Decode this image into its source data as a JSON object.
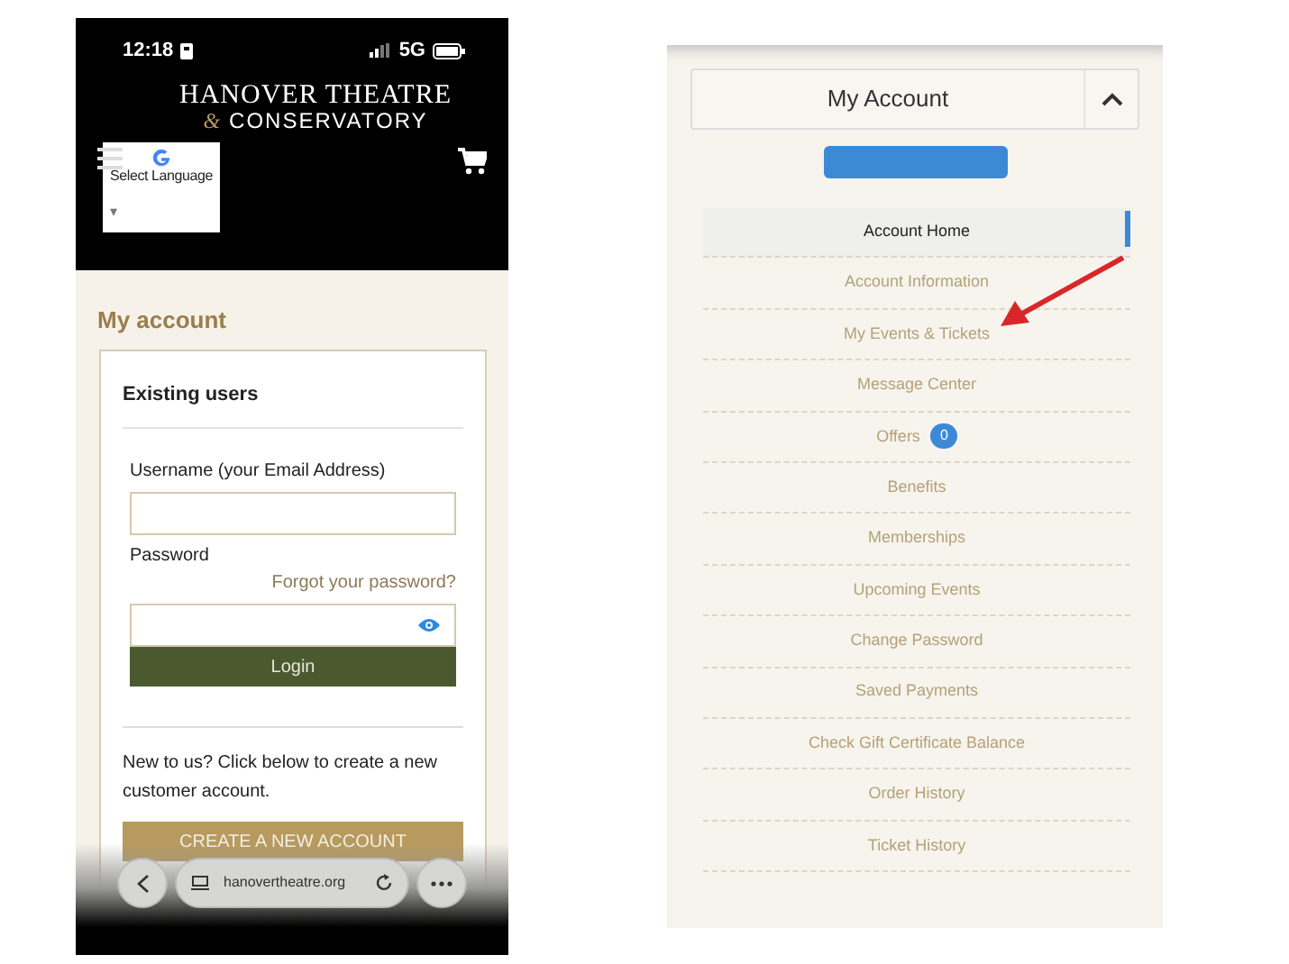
{
  "status_bar": {
    "time": "12:18",
    "network": "5G"
  },
  "logo": {
    "line1": "HANOVER THEATRE",
    "ampersand": "&",
    "line2": "CONSERVATORY"
  },
  "language_widget": {
    "label": "Select Language",
    "caret": "▾"
  },
  "account_page": {
    "heading": "My account",
    "section_title": "Existing users",
    "username_label": "Username (your Email Address)",
    "password_label": "Password",
    "forgot_link": "Forgot your password?",
    "login_button": "Login",
    "new_customer_text": "New to us? Click below to create a new customer account.",
    "create_button": "CREATE A NEW ACCOUNT"
  },
  "browser_bar": {
    "url": "hanovertheatre.org"
  },
  "account_menu": {
    "title": "My Account",
    "expanded": true,
    "items": [
      {
        "label": "Account Home",
        "selected": true
      },
      {
        "label": "Account Information",
        "selected": false
      },
      {
        "label": "My Events & Tickets",
        "selected": false
      },
      {
        "label": "Message Center",
        "selected": false
      },
      {
        "label": "Offers",
        "selected": false,
        "badge": "0"
      },
      {
        "label": "Benefits",
        "selected": false
      },
      {
        "label": "Memberships",
        "selected": false
      },
      {
        "label": "Upcoming Events",
        "selected": false
      },
      {
        "label": "Change Password",
        "selected": false
      },
      {
        "label": "Saved Payments",
        "selected": false
      },
      {
        "label": "Check Gift Certificate Balance",
        "selected": false
      },
      {
        "label": "Order History",
        "selected": false
      },
      {
        "label": "Ticket History",
        "selected": false
      }
    ]
  }
}
